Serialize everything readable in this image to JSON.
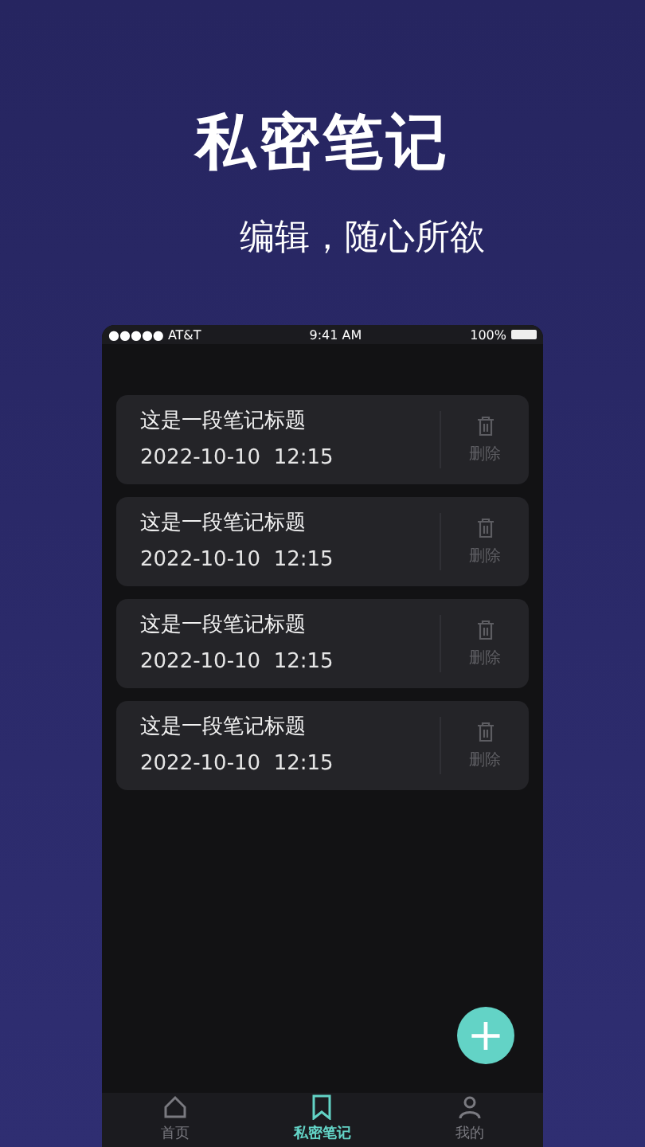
{
  "headline": "私密笔记",
  "subtitle": "编辑，随心所欲",
  "status_bar": {
    "carrier": "●●●●● AT&T",
    "time": "9:41 AM",
    "battery": "100%"
  },
  "notes": [
    {
      "title": "这是一段笔记标题",
      "date": "2022-10-10  12:15",
      "action": "删除"
    },
    {
      "title": "这是一段笔记标题",
      "date": "2022-10-10  12:15",
      "action": "删除"
    },
    {
      "title": "这是一段笔记标题",
      "date": "2022-10-10  12:15",
      "action": "删除"
    },
    {
      "title": "这是一段笔记标题",
      "date": "2022-10-10  12:15",
      "action": "删除"
    }
  ],
  "fab": "+",
  "tabs": [
    {
      "label": "首页",
      "kind": "home",
      "selected": false
    },
    {
      "label": "私密笔记",
      "kind": "notes",
      "selected": true
    },
    {
      "label": "我的",
      "kind": "profile",
      "selected": false
    }
  ]
}
